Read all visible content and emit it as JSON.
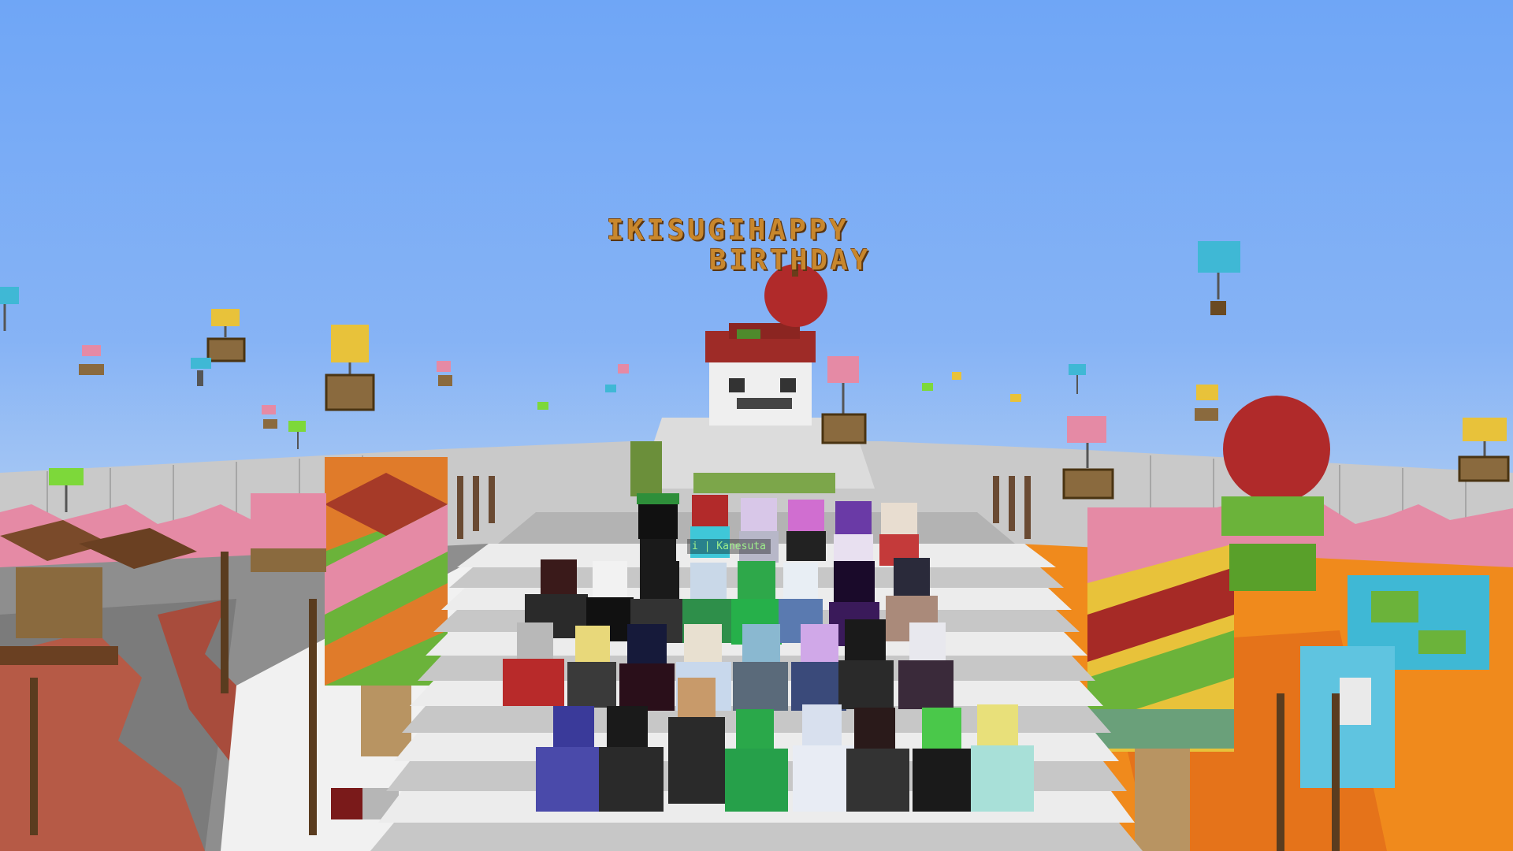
{
  "game": "Minecraft",
  "scene": {
    "banner_line1": "IKISUGIHAPPY",
    "banner_line2": "BIRTHDAY",
    "nametag": "i | Kanesuta"
  },
  "colors": {
    "sky": "#86b3f5",
    "wall": "#c9c9c9",
    "stairs": "#e4e4e4",
    "lava": "#f08a1c",
    "banner_text": "#c8872d",
    "pink_terracotta": "#e58aa5"
  }
}
